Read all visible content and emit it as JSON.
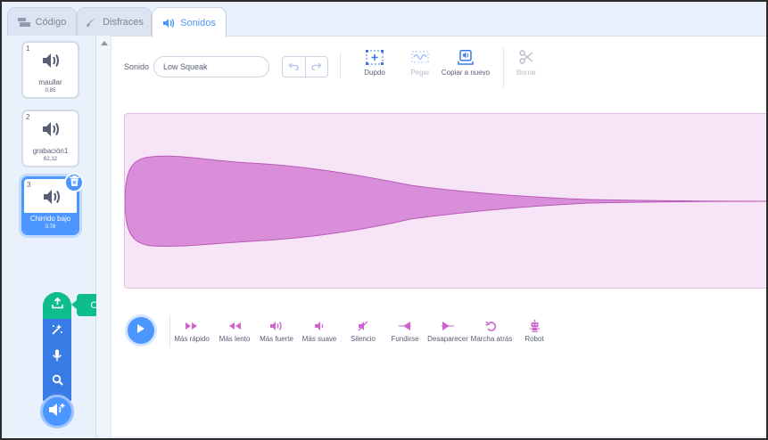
{
  "tabs": [
    {
      "label": "Código",
      "icon": "code-icon",
      "active": false
    },
    {
      "label": "Disfraces",
      "icon": "brush-icon",
      "active": false
    },
    {
      "label": "Sonidos",
      "icon": "speaker-icon",
      "active": true
    }
  ],
  "sounds": [
    {
      "number": "1",
      "name": "maullar",
      "duration": "0,85",
      "selected": false
    },
    {
      "number": "2",
      "name": "grabación1",
      "duration": "62,12",
      "selected": false
    },
    {
      "number": "3",
      "name": "Chirrido bajo",
      "duration": "0,78",
      "selected": true
    }
  ],
  "add_menu": {
    "tooltip": "Cargar sonido",
    "items": [
      "upload-icon",
      "surprise-icon",
      "microphone-icon",
      "search-icon"
    ],
    "main_icon": "add-sound-icon"
  },
  "editor": {
    "name_label": "Sonido",
    "name_value": "Low Squeak",
    "tools": {
      "copy": "Dupdo",
      "paste": "Pegar",
      "copy_new": "Copiar a nuevo",
      "delete": "Borrar"
    }
  },
  "effects": [
    {
      "label": "Más rápido",
      "icon": "faster-icon"
    },
    {
      "label": "Más lento",
      "icon": "slower-icon"
    },
    {
      "label": "Más fuerte",
      "icon": "louder-icon"
    },
    {
      "label": "Más suave",
      "icon": "softer-icon"
    },
    {
      "label": "Silencio",
      "icon": "mute-icon"
    },
    {
      "label": "Fundirse",
      "icon": "fade-in-icon"
    },
    {
      "label": "Desaparecer",
      "icon": "fade-out-icon"
    },
    {
      "label": "Marcha atrás",
      "icon": "reverse-icon"
    },
    {
      "label": "Robot",
      "icon": "robot-icon"
    }
  ],
  "colors": {
    "accent": "#4c97ff",
    "upload_green": "#0fbd8c",
    "effect_purple": "#cf63cf",
    "wave_fill": "#d88ed8",
    "wave_bg": "#f7e4f6"
  }
}
